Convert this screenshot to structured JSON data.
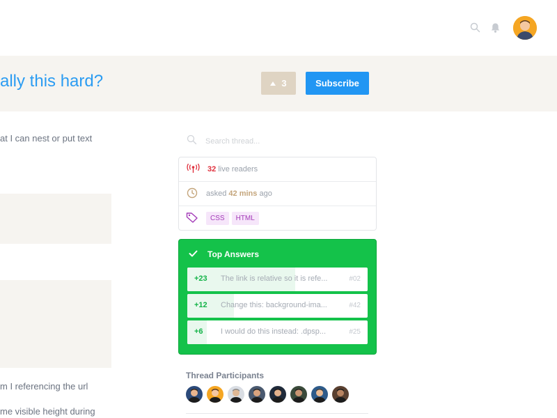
{
  "header": {
    "search_icon": "search-icon",
    "bell_icon": "bell-icon",
    "avatar": "user-avatar"
  },
  "thread": {
    "title": "ally this hard?",
    "vote_count": "3",
    "subscribe_label": "Subscribe"
  },
  "post": {
    "line1": "at I can nest or put text",
    "line2": "m I referencing the url",
    "line3": "me visible height during"
  },
  "sidebar": {
    "search_placeholder": "Search thread...",
    "live_readers_count": "32",
    "live_readers_label": "live readers",
    "asked_prefix": "asked",
    "asked_time": "42 mins",
    "asked_suffix": "ago",
    "tags": [
      "CSS",
      "HTML"
    ],
    "top_answers": {
      "title": "Top Answers",
      "items": [
        {
          "score": "+23",
          "text": "The link is relative so it is refe...",
          "ref": "#02",
          "fill": 0.6
        },
        {
          "score": "+12",
          "text": "Change this: background-ima...",
          "ref": "#42",
          "fill": 0.26
        },
        {
          "score": "+6",
          "text": "I would do this instead: .dpsp...",
          "ref": "#25",
          "fill": 0.11
        }
      ]
    },
    "participants_title": "Thread Participants",
    "participants_count": 8
  },
  "colors": {
    "accent_blue": "#2196f3",
    "green": "#14c24a",
    "live_red": "#e0313e",
    "tag_purple": "#a33ab8"
  }
}
